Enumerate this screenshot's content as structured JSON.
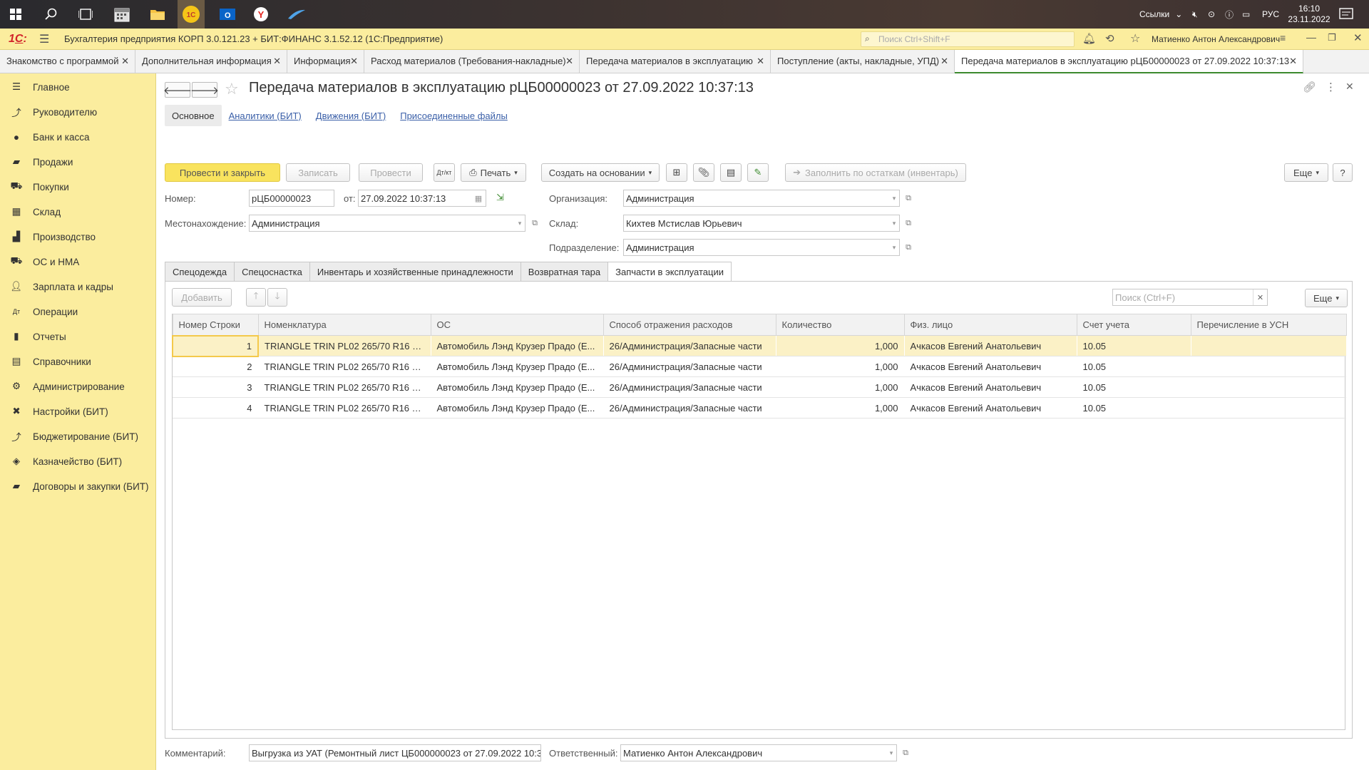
{
  "taskbar": {
    "links_label": "Ссылки",
    "lang": "РУС",
    "time": "16:10",
    "date": "23.11.2022"
  },
  "app": {
    "title": "Бухгалтерия предприятия КОРП 3.0.121.23 + БИТ:ФИНАНС 3.1.52.12  (1С:Предприятие)",
    "search_placeholder": "Поиск Ctrl+Shift+F",
    "user": "Матиенко Антон Александрович"
  },
  "window_tabs": [
    {
      "label": "Знакомство с программой"
    },
    {
      "label": "Дополнительная информация"
    },
    {
      "label": "Информация"
    },
    {
      "label": "Расход материалов (Требования-накладные)"
    },
    {
      "label": "Передача материалов в эксплуатацию"
    },
    {
      "label": "Поступление (акты, накладные, УПД)"
    },
    {
      "label": "Передача материалов в эксплуатацию рЦБ00000023 от 27.09.2022 10:37:13"
    }
  ],
  "sidebar": {
    "items": [
      {
        "label": "Главное",
        "icon": "menu-icon"
      },
      {
        "label": "Руководителю",
        "icon": "chart-line-icon"
      },
      {
        "label": "Банк и касса",
        "icon": "coin-icon"
      },
      {
        "label": "Продажи",
        "icon": "bag-icon"
      },
      {
        "label": "Покупки",
        "icon": "cart-icon"
      },
      {
        "label": "Склад",
        "icon": "warehouse-icon"
      },
      {
        "label": "Производство",
        "icon": "factory-icon"
      },
      {
        "label": "ОС и НМА",
        "icon": "truck-icon"
      },
      {
        "label": "Зарплата и кадры",
        "icon": "person-icon"
      },
      {
        "label": "Операции",
        "icon": "dt-kt-icon"
      },
      {
        "label": "Отчеты",
        "icon": "bar-chart-icon"
      },
      {
        "label": "Справочники",
        "icon": "book-icon"
      },
      {
        "label": "Администрирование",
        "icon": "gear-icon"
      },
      {
        "label": "Настройки (БИТ)",
        "icon": "tools-icon"
      },
      {
        "label": "Бюджетирование (БИТ)",
        "icon": "budget-icon"
      },
      {
        "label": "Казначейство (БИТ)",
        "icon": "money-icon"
      },
      {
        "label": "Договоры и закупки (БИТ)",
        "icon": "folder-icon"
      }
    ]
  },
  "document": {
    "title": "Передача материалов в эксплуатацию рЦБ00000023 от 27.09.2022 10:37:13",
    "section_tabs": [
      "Основное",
      "Аналитики (БИТ)",
      "Движения (БИТ)",
      "Присоединенные файлы"
    ],
    "toolbar": {
      "post_close": "Провести и закрыть",
      "save": "Записать",
      "post": "Провести",
      "print": "Печать",
      "create_based": "Создать на основании",
      "fill_remains": "Заполнить по остаткам (инвентарь)",
      "more": "Еще",
      "help": "?"
    },
    "fields": {
      "number_label": "Номер:",
      "number": "рЦБ00000023",
      "date_label": "от:",
      "date": "27.09.2022 10:37:13",
      "location_label": "Местонахождение:",
      "location": "Администрация",
      "org_label": "Организация:",
      "org": "Администрация",
      "warehouse_label": "Склад:",
      "warehouse": "Кихтев Мстислав Юрьевич",
      "division_label": "Подразделение:",
      "division": "Администрация"
    },
    "table_tabs": [
      "Спецодежда",
      "Спецоснастка",
      "Инвентарь и хозяйственные принадлежности",
      "Возвратная тара",
      "Запчасти в эксплуатации"
    ],
    "table_toolbar": {
      "add": "Добавить",
      "search_placeholder": "Поиск (Ctrl+F)",
      "more": "Еще"
    },
    "table": {
      "columns": [
        "Номер Строки",
        "Номенклатура",
        "ОС",
        "Способ отражения расходов",
        "Количество",
        "Физ. лицо",
        "Счет учета",
        "Перечисление в УСН"
      ],
      "rows": [
        [
          "1",
          "TRIANGLE TRIN PL02 265/70 R16 1...",
          "Автомобиль Лэнд Крузер Прадо (Е...",
          "26/Администрация/Запасные части",
          "1,000",
          "Ачкасов Евгений Анатольевич",
          "10.05",
          ""
        ],
        [
          "2",
          "TRIANGLE TRIN PL02 265/70 R16 1...",
          "Автомобиль Лэнд Крузер Прадо (Е...",
          "26/Администрация/Запасные части",
          "1,000",
          "Ачкасов Евгений Анатольевич",
          "10.05",
          ""
        ],
        [
          "3",
          "TRIANGLE TRIN PL02 265/70 R16 1...",
          "Автомобиль Лэнд Крузер Прадо (Е...",
          "26/Администрация/Запасные части",
          "1,000",
          "Ачкасов Евгений Анатольевич",
          "10.05",
          ""
        ],
        [
          "4",
          "TRIANGLE TRIN PL02 265/70 R16 1...",
          "Автомобиль Лэнд Крузер Прадо (Е...",
          "26/Администрация/Запасные части",
          "1,000",
          "Ачкасов Евгений Анатольевич",
          "10.05",
          ""
        ]
      ]
    },
    "footer": {
      "comment_label": "Комментарий:",
      "comment": "Выгрузка из УАТ (Ремонтный лист ЦБ000000023 от 27.09.2022 10:3",
      "responsible_label": "Ответственный:",
      "responsible": "Матиенко Антон Александрович"
    }
  },
  "colors": {
    "accent_yellow": "#fbed9e",
    "primary_button": "#f9e35e",
    "selected_row": "#fbf1c6",
    "link": "#3a5fa8"
  }
}
